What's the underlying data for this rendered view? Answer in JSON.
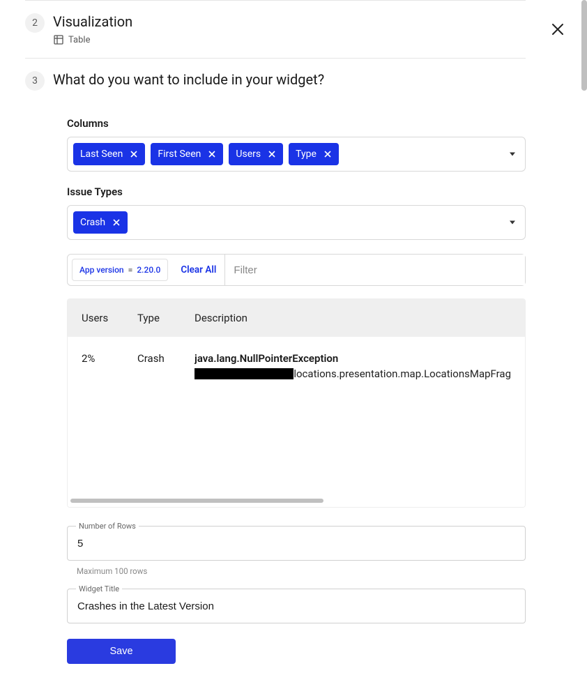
{
  "close_label": "Close",
  "step2": {
    "number": "2",
    "title": "Visualization",
    "subtitle": "Table"
  },
  "step3": {
    "number": "3",
    "title": "What do you want to include in your widget?"
  },
  "columns": {
    "label": "Columns",
    "items": [
      "Last Seen",
      "First Seen",
      "Users",
      "Type"
    ]
  },
  "issue_types": {
    "label": "Issue Types",
    "items": [
      "Crash"
    ]
  },
  "filters": {
    "chip": {
      "key": "App version",
      "op": "=",
      "value": "2.20.0"
    },
    "clear_all": "Clear All",
    "placeholder": "Filter"
  },
  "table": {
    "headers": {
      "users": "Users",
      "type": "Type",
      "description": "Description"
    },
    "rows": [
      {
        "users": "2%",
        "type": "Crash",
        "desc_top": "java.lang.NullPointerException",
        "desc_bot": "locations.presentation.map.LocationsMapFrag"
      }
    ]
  },
  "rows_field": {
    "label": "Number of Rows",
    "value": "5",
    "helper": "Maximum 100 rows"
  },
  "title_field": {
    "label": "Widget Title",
    "value": "Crashes in the Latest Version"
  },
  "save": "Save"
}
